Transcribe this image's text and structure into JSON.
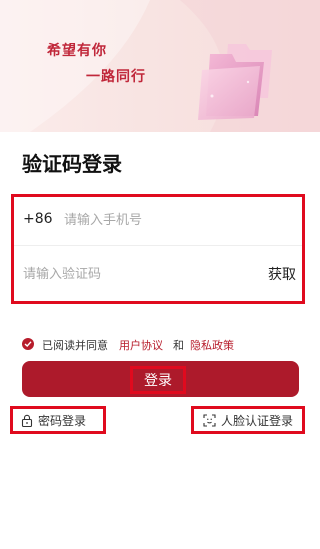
{
  "banner": {
    "slogan_line1": "希望有你",
    "slogan_line2": "一路同行",
    "illustration": "folder-illustration"
  },
  "page_title": "验证码登录",
  "form": {
    "country_code": "+86",
    "phone_placeholder": "请输入手机号",
    "code_placeholder": "请输入验证码",
    "get_code_label": "获取"
  },
  "agreement": {
    "checked": true,
    "prefix": "已阅读并同意",
    "user_agreement": "用户协议",
    "and": "和",
    "privacy_policy": "隐私政策"
  },
  "login_button_label": "登录",
  "alt_login": {
    "password_label": "密码登录",
    "password_icon": "lock-icon",
    "face_label": "人脸认证登录",
    "face_icon": "face-scan-icon"
  },
  "colors": {
    "accent": "#ad1a2b",
    "highlight_box": "#e00a1e",
    "banner_text": "#c0273a"
  }
}
